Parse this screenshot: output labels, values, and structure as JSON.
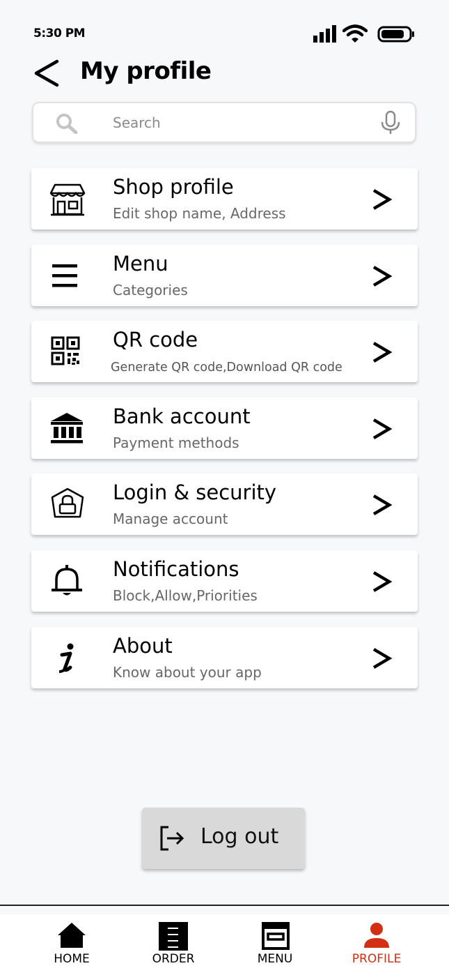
{
  "status_bar": {
    "time": "5:30 PM"
  },
  "header": {
    "title": "My profile"
  },
  "search": {
    "placeholder": "Search"
  },
  "menu_items": [
    {
      "title": "Shop profile",
      "subtitle": "Edit shop name, Address",
      "icon": "shop-icon"
    },
    {
      "title": "Menu",
      "subtitle": "Categories",
      "icon": "menu-lines-icon"
    },
    {
      "title": "QR code",
      "subtitle": "Generate QR code,Download QR code",
      "icon": "qr-code-icon"
    },
    {
      "title": "Bank account",
      "subtitle": "Payment methods",
      "icon": "bank-icon"
    },
    {
      "title": "Login & security",
      "subtitle": "Manage account",
      "icon": "lock-icon"
    },
    {
      "title": "Notifications",
      "subtitle": "Block,Allow,Priorities",
      "icon": "bell-icon"
    },
    {
      "title": "About",
      "subtitle": "Know about your app",
      "icon": "info-icon"
    }
  ],
  "logout": {
    "label": "Log out"
  },
  "bottom_nav": {
    "items": [
      {
        "label": "HOME",
        "icon": "home-icon"
      },
      {
        "label": "ORDER",
        "icon": "order-icon"
      },
      {
        "label": "MENU",
        "icon": "menu-card-icon"
      },
      {
        "label": "PROFILE",
        "icon": "person-icon"
      }
    ],
    "active_index": 3
  },
  "colors": {
    "accent": "#d32f12",
    "background": "#f7f8fa",
    "subtitle": "#676767"
  }
}
